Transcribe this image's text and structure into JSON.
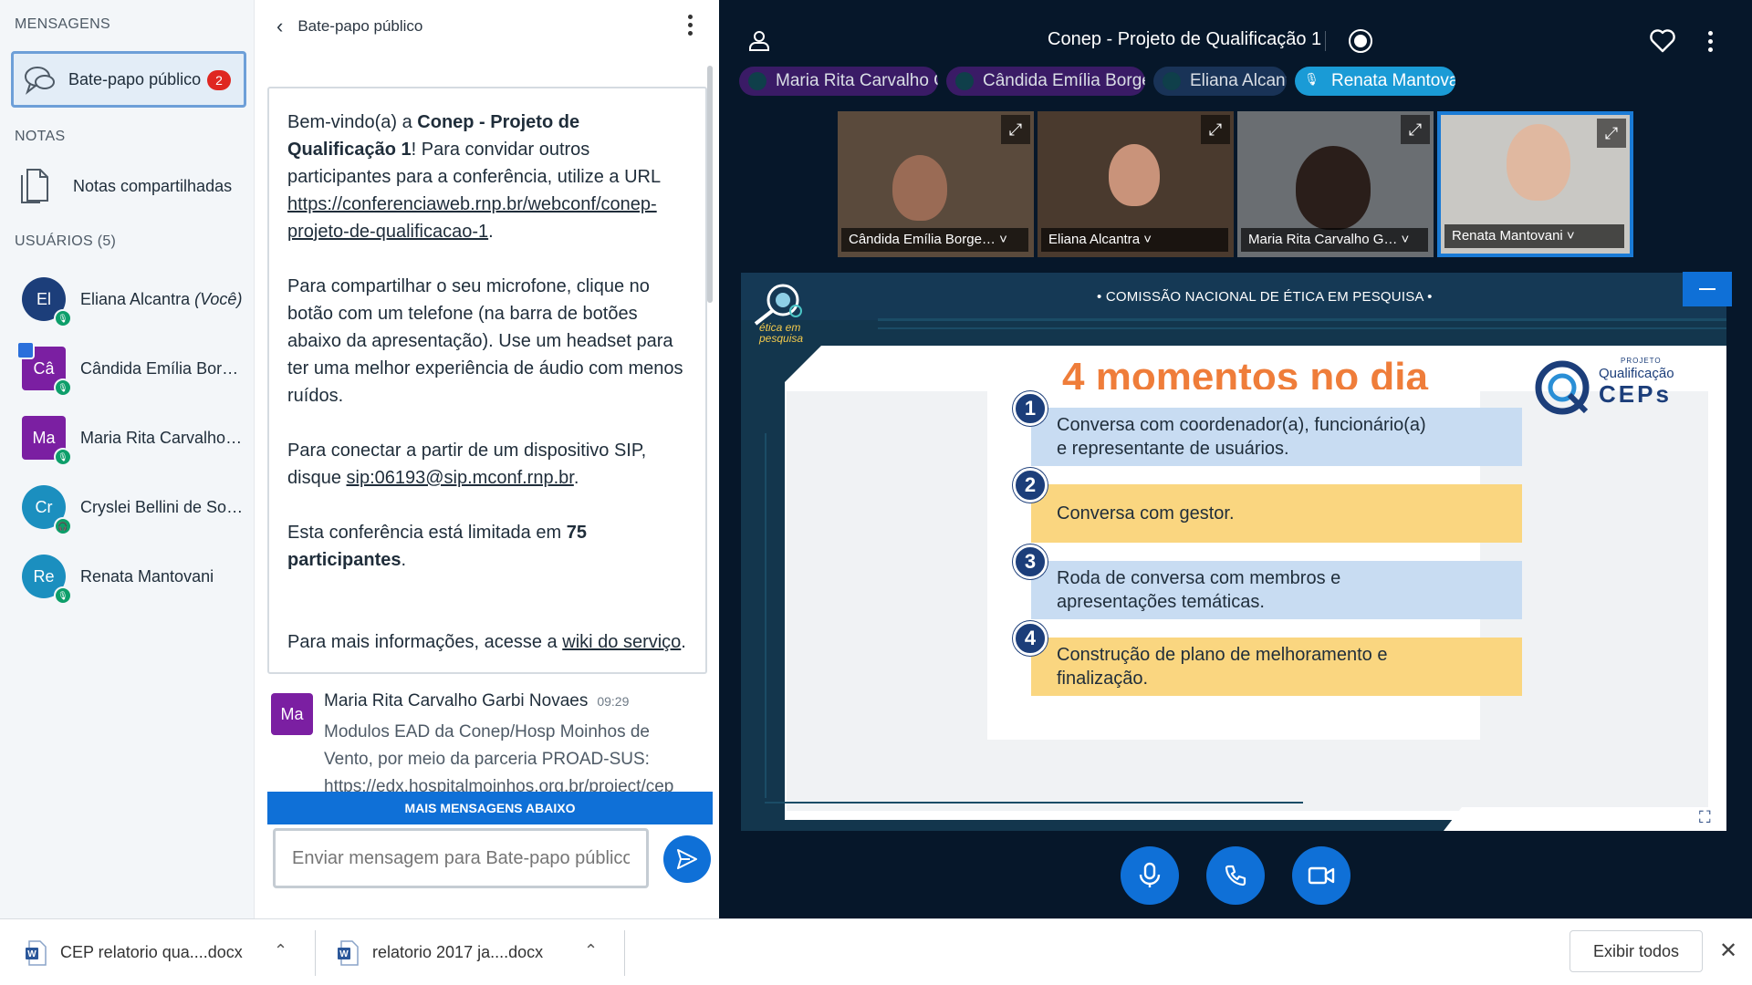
{
  "userlist": {
    "messages_title": "MENSAGENS",
    "public_chat": {
      "label": "Bate-papo público",
      "unread": "2"
    },
    "notes_title": "NOTAS",
    "shared_notes": "Notas compartilhadas",
    "users_title": "USUÁRIOS (5)",
    "users": [
      {
        "initials": "El",
        "name": "Eliana Alcantra",
        "suffix": "(Você)",
        "color": "#1c3e7a",
        "shape": "circle",
        "status": "mic"
      },
      {
        "initials": "Câ",
        "name": "Cândida Emília Borg…",
        "color": "#7b1fa2",
        "shape": "square",
        "status": "mic",
        "presenter": true
      },
      {
        "initials": "Ma",
        "name": "Maria Rita Carvalho …",
        "color": "#7b1fa2",
        "shape": "square",
        "status": "mic"
      },
      {
        "initials": "Cr",
        "name": "Cryslei Bellini de So…",
        "color": "#1b8fbf",
        "shape": "circle",
        "status": "listen"
      },
      {
        "initials": "Re",
        "name": "Renata Mantovani",
        "color": "#1b8fbf",
        "shape": "circle",
        "status": "mic"
      }
    ]
  },
  "chat": {
    "title": "Bate-papo público",
    "welcome": {
      "p1_a": "Bem-vindo(a) a ",
      "p1_b": "Conep - Projeto de Qualificação 1",
      "p1_c": "! Para convidar outros participantes para a conferência, utilize a URL ",
      "p1_url": "https://conferenciaweb.rnp.br/webconf/conep-projeto-de-qualificacao-1",
      "p1_end": ".",
      "p2": "Para compartilhar o seu microfone, clique no botão com um telefone (na barra de botões abaixo da apresentação). Use um headset para ter uma melhor experiência de áudio com menos ruídos.",
      "p3_a": "Para conectar a partir de um dispositivo SIP, disque ",
      "p3_sip": "sip:06193@sip.mconf.rnp.br",
      "p3_end": ".",
      "p4_a": "Esta conferência está limitada em ",
      "p4_b": "75 participantes",
      "p4_end": ".",
      "p5_a": "Para mais informações, acesse a ",
      "p5_link": "wiki do serviço",
      "p5_end": "."
    },
    "message": {
      "initials": "Ma",
      "author": "Maria Rita Carvalho Garbi Novaes",
      "time": "09:29",
      "text": "Modulos EAD da Conep/Hosp Moinhos de Vento, por meio da parceria PROAD-SUS:",
      "link": "https://edx.hospitalmoinhos.org.br/project/cep"
    },
    "more_messages": "MAIS MENSAGENS ABAIXO",
    "input_placeholder": "Enviar mensagem para Bate-papo público"
  },
  "main": {
    "meeting_title": "Conep - Projeto de Qualificação 1",
    "talkers": [
      {
        "name": "Maria Rita Carvalho G…",
        "style": "purple"
      },
      {
        "name": "Cândida Emília Borge…",
        "style": "purple"
      },
      {
        "name": "Eliana Alcantra",
        "style": "dark"
      },
      {
        "name": "Renata Mantovani",
        "style": "active"
      }
    ],
    "videos": [
      {
        "name": "Cândida Emília Borge…",
        "bg": "#5a4a3c"
      },
      {
        "name": "Eliana Alcantra",
        "bg": "#4a3a2e"
      },
      {
        "name": "Maria Rita Carvalho G…",
        "bg": "#6a6e72"
      },
      {
        "name": "Renata Mantovani",
        "bg": "#c9c8c4"
      }
    ],
    "slide": {
      "header": "• COMISSÃO NACIONAL DE ÉTICA EM PESQUISA •",
      "logo_left": "ética em pesquisa",
      "title": "4 momentos no dia",
      "logo_right_top": "PROJETO",
      "logo_right_a": "Qualificação",
      "logo_right_b": "CEPs",
      "steps": [
        {
          "num": "1",
          "text": "Conversa com coordenador(a), funcionário(a) e representante de usuários.",
          "color": "blue"
        },
        {
          "num": "2",
          "text": "Conversa com gestor.",
          "color": "yellow"
        },
        {
          "num": "3",
          "text": "Roda de conversa com membros e apresentações temáticas.",
          "color": "blue"
        },
        {
          "num": "4",
          "text": "Construção de plano de melhoramento e finalização.",
          "color": "yellow"
        }
      ]
    }
  },
  "downloads": {
    "items": [
      {
        "name": "CEP relatorio qua....docx"
      },
      {
        "name": "relatorio 2017 ja....docx"
      }
    ],
    "show_all": "Exibir todos"
  }
}
